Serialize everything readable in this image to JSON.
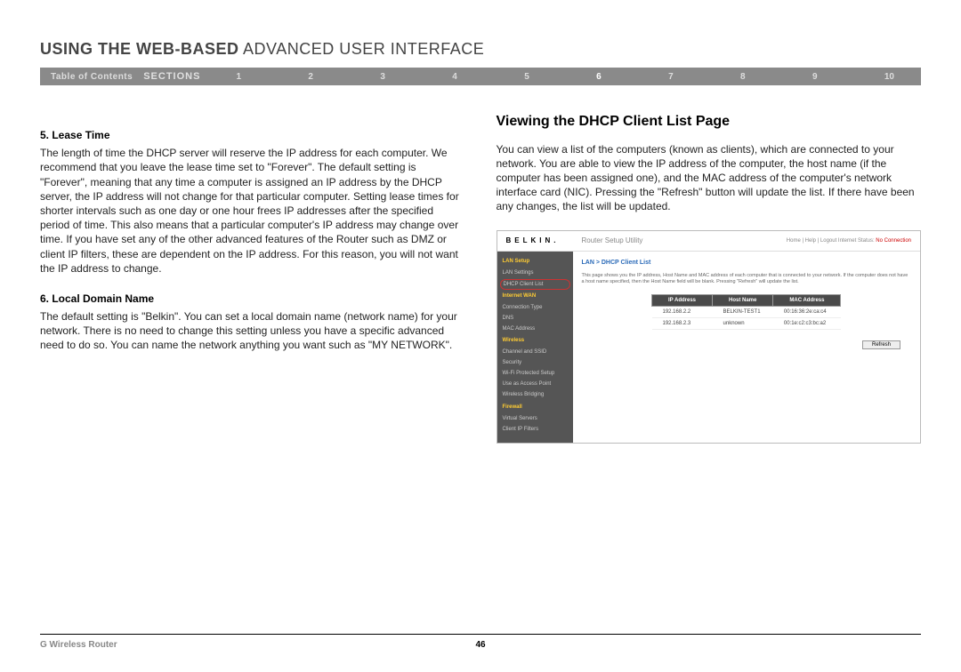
{
  "header": {
    "title_bold": "USING THE WEB-BASED",
    "title_thin": " ADVANCED USER INTERFACE",
    "toc": "Table of Contents",
    "sections_label": "SECTIONS",
    "section_numbers": [
      "1",
      "2",
      "3",
      "4",
      "5",
      "6",
      "7",
      "8",
      "9",
      "10"
    ],
    "active_section": "6"
  },
  "left": {
    "h5": "5.   Lease Time",
    "p5": "The length of time the DHCP server will reserve the IP address for each computer. We recommend that you leave the lease time set to \"Forever\". The default setting is \"Forever\", meaning that any time a computer is assigned an IP address by the DHCP server, the IP address will not change for that particular computer. Setting lease times for shorter intervals such as one day or one hour frees IP addresses after the specified period of time. This also means that a particular computer's IP address may change over time. If you have set any of the other advanced features of the Router such as DMZ or client IP filters, these are dependent on the IP address. For this reason, you will not want the IP address to change.",
    "h6": "6.   Local Domain Name",
    "p6": "The default setting is \"Belkin\". You can set a local domain name (network name) for your network. There is no need to change this setting unless you have a specific advanced need to do so. You can name the network anything you want such as \"MY NETWORK\"."
  },
  "right": {
    "head": "Viewing the DHCP Client List Page",
    "p": "You can view a list of the computers (known as clients), which are connected to your network. You are able to view the IP address of the computer, the host name (if the computer has been assigned one), and the MAC address of the computer's network interface card (NIC). Pressing the \"Refresh\" button will update the list. If there have been any changes, the list will be updated."
  },
  "screenshot": {
    "logo": "BELKIN.",
    "util": "Router Setup Utility",
    "topnav_left": "Home | Help | Logout   Internet Status:",
    "topnav_status": "No Connection",
    "sidebar": [
      {
        "type": "cat",
        "label": "LAN Setup"
      },
      {
        "type": "item",
        "label": "LAN Settings"
      },
      {
        "type": "item-hl",
        "label": "DHCP Client List"
      },
      {
        "type": "cat",
        "label": "Internet WAN"
      },
      {
        "type": "item",
        "label": "Connection Type"
      },
      {
        "type": "item",
        "label": "DNS"
      },
      {
        "type": "item",
        "label": "MAC Address"
      },
      {
        "type": "cat",
        "label": "Wireless"
      },
      {
        "type": "item",
        "label": "Channel and SSID"
      },
      {
        "type": "item",
        "label": "Security"
      },
      {
        "type": "item",
        "label": "Wi-Fi Protected Setup"
      },
      {
        "type": "item",
        "label": "Use as Access Point"
      },
      {
        "type": "item",
        "label": "Wireless Bridging"
      },
      {
        "type": "cat",
        "label": "Firewall"
      },
      {
        "type": "item",
        "label": "Virtual Servers"
      },
      {
        "type": "item",
        "label": "Client IP Filters"
      }
    ],
    "breadcrumb": "LAN > DHCP Client List",
    "desc": "This page shows you the IP address, Host Name and MAC address of each computer that is connected to your network. If the computer does not have a host name specified, then the Host Name field will be blank. Pressing \"Refresh\" will update the list.",
    "table": {
      "headers": [
        "IP Address",
        "Host Name",
        "MAC Address"
      ],
      "rows": [
        [
          "192.168.2.2",
          "BELKIN-TEST1",
          "00:16:36:2e:ca:c4"
        ],
        [
          "192.168.2.3",
          "unknown",
          "00:1e:c2:c3:bc:a2"
        ]
      ]
    },
    "refresh": "Refresh"
  },
  "footer": {
    "product": "G Wireless Router",
    "page": "46"
  }
}
